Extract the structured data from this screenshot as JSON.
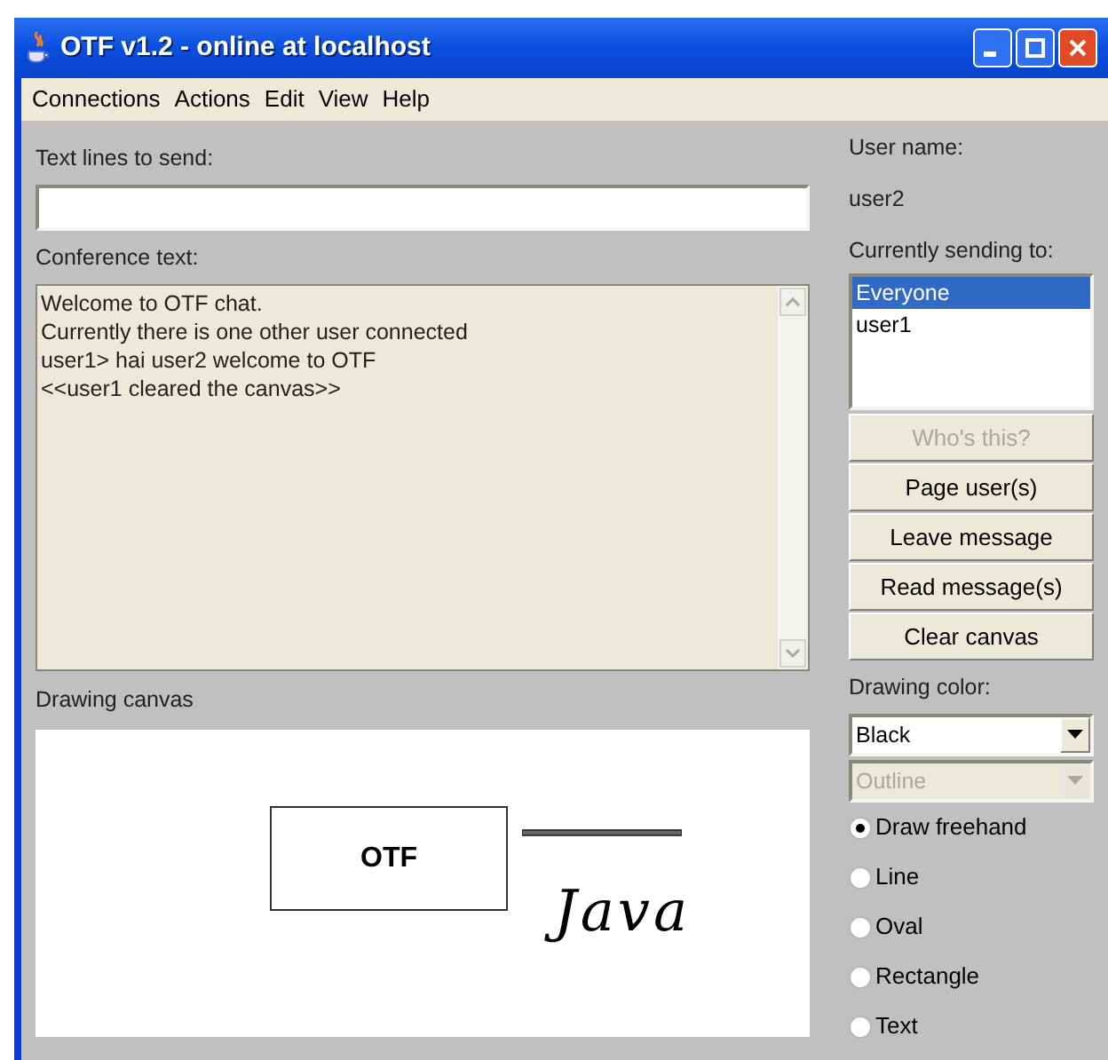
{
  "window": {
    "title": "OTF v1.2 - online at localhost"
  },
  "menu": [
    "Connections",
    "Actions",
    "Edit",
    "View",
    "Help"
  ],
  "send": {
    "label": "Text lines to send:"
  },
  "conference": {
    "label": "Conference text:",
    "lines": [
      "Welcome to OTF chat.",
      "Currently there is one other user connected",
      "user1> hai user2 welcome to OTF",
      "<<user1 cleared the canvas>>"
    ]
  },
  "canvas": {
    "label": "Drawing canvas",
    "shapes": [
      {
        "kind": "rectangle",
        "text": "OTF"
      },
      {
        "kind": "line"
      },
      {
        "kind": "freehand",
        "text": "Java"
      }
    ]
  },
  "user": {
    "label": "User name:",
    "value": "user2"
  },
  "recipients": {
    "label": "Currently sending to:",
    "items": [
      {
        "label": "Everyone",
        "selected": true
      },
      {
        "label": "user1",
        "selected": false
      }
    ]
  },
  "buttons": [
    {
      "label": "Who's this?",
      "disabled": true
    },
    {
      "label": "Page user(s)",
      "disabled": false
    },
    {
      "label": "Leave message",
      "disabled": false
    },
    {
      "label": "Read message(s)",
      "disabled": false
    },
    {
      "label": "Clear canvas",
      "disabled": false
    }
  ],
  "drawing_color": {
    "label": "Drawing color:",
    "value": "Black",
    "disabled": false
  },
  "fill_mode": {
    "value": "Outline",
    "disabled": true
  },
  "tools": [
    {
      "label": "Draw freehand",
      "selected": true
    },
    {
      "label": "Line",
      "selected": false
    },
    {
      "label": "Oval",
      "selected": false
    },
    {
      "label": "Rectangle",
      "selected": false
    },
    {
      "label": "Text",
      "selected": false
    }
  ]
}
